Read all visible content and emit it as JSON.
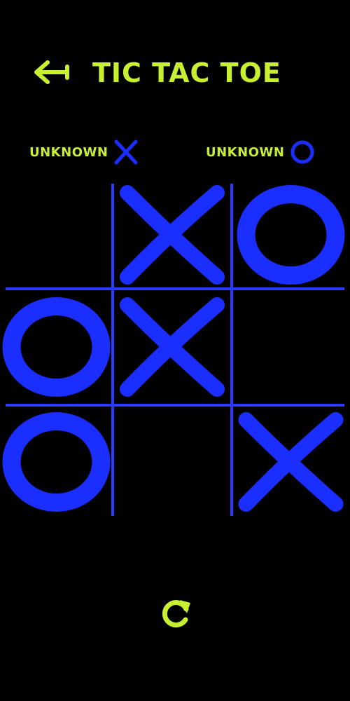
{
  "header": {
    "title": "TIC TAC TOE",
    "back_icon": "arrow-left-icon"
  },
  "players": [
    {
      "name": "UNKNOWN",
      "mark": "X"
    },
    {
      "name": "UNKNOWN",
      "mark": "O"
    }
  ],
  "board": {
    "rows": 3,
    "cols": 3,
    "cells": [
      "",
      "X",
      "O",
      "O",
      "X",
      "",
      "O",
      "",
      "X"
    ]
  },
  "controls": {
    "reset_icon": "refresh-icon"
  },
  "colors": {
    "background": "#000000",
    "accent": "#c8f030",
    "mark": "#1a2eff",
    "grid": "#2a3aff"
  }
}
